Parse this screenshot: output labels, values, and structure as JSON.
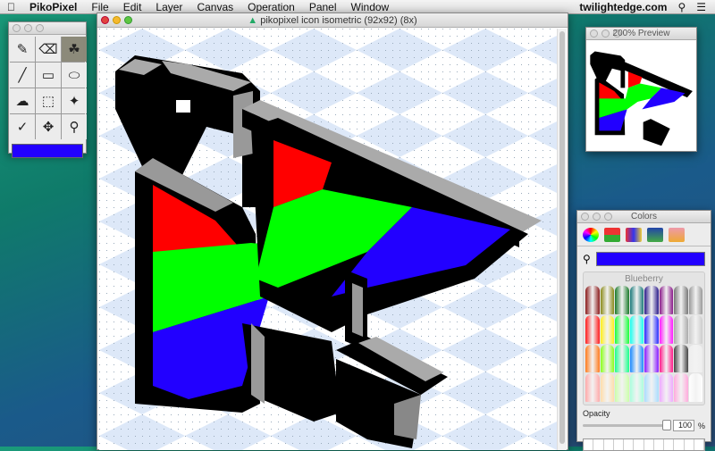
{
  "menubar": {
    "app": "PikoPixel",
    "items": [
      "File",
      "Edit",
      "Layer",
      "Canvas",
      "Operation",
      "Panel",
      "Window"
    ],
    "host": "twilightedge.com"
  },
  "tools": {
    "items": [
      "pencil",
      "eraser",
      "fill",
      "line",
      "rectangle",
      "ellipse",
      "freeform-select",
      "rect-select",
      "magic-wand",
      "eyedropper",
      "move",
      "magnifier"
    ],
    "selected": "fill",
    "fill_color": "#2200ff"
  },
  "main": {
    "title": "pikopixel icon isometric (92x92) (8x)"
  },
  "preview": {
    "title": "200% Preview"
  },
  "colors": {
    "title": "Colors",
    "current_color": "#2200ff",
    "crayon_name": "Blueberry",
    "opacity_label": "Opacity",
    "opacity_value": "100",
    "percent": "%",
    "crayons": [
      "#8b1a1a",
      "#8a8a1a",
      "#1a7a2a",
      "#1a7a7a",
      "#2a1a8a",
      "#8a1a8a",
      "#777",
      "#999",
      "#ff1a1a",
      "#ffee1a",
      "#1aff3a",
      "#1affee",
      "#2a2aff",
      "#ff1aff",
      "#aaa",
      "#ccc",
      "#ff7a1a",
      "#8aff1a",
      "#1aff8a",
      "#1a8aff",
      "#8a1aff",
      "#ff1a8a",
      "#444",
      "#eee",
      "#ffaaaa",
      "#ffddaa",
      "#ccffaa",
      "#aaffdd",
      "#aaddff",
      "#eeaaff",
      "#ffaadd",
      "#fff"
    ]
  }
}
